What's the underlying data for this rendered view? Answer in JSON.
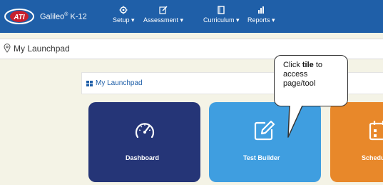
{
  "brand": {
    "name": "Galileo",
    "reg": "®",
    "suffix": " K-12",
    "mark_text": "ATI"
  },
  "nav": [
    {
      "label": "Setup ▾",
      "icon": "gear-icon"
    },
    {
      "label": "Assessment ▾",
      "icon": "edit-icon"
    },
    {
      "label": "Curriculum ▾",
      "icon": "book-icon"
    },
    {
      "label": "Reports ▾",
      "icon": "bar-chart-icon"
    }
  ],
  "breadcrumb": {
    "text": "My Launchpad",
    "icon": "map-pin-icon"
  },
  "panel": {
    "title": "My Launchpad",
    "icon": "grid-icon"
  },
  "tiles": [
    {
      "label": "Dashboard",
      "icon": "speedometer-icon",
      "color": "#253577"
    },
    {
      "label": "Test Builder",
      "icon": "edit-icon",
      "color": "#3f9ee0"
    },
    {
      "label": "Schedu",
      "icon": "calendar-icon",
      "color": "#e8882a"
    }
  ],
  "callout": {
    "line1_prefix": "Click ",
    "line1_bold": "tile",
    "line1_suffix": " to",
    "line2": "access",
    "line3": "page/tool"
  },
  "colors": {
    "topbar": "#1f5fa8",
    "background": "#f4f3e6"
  }
}
